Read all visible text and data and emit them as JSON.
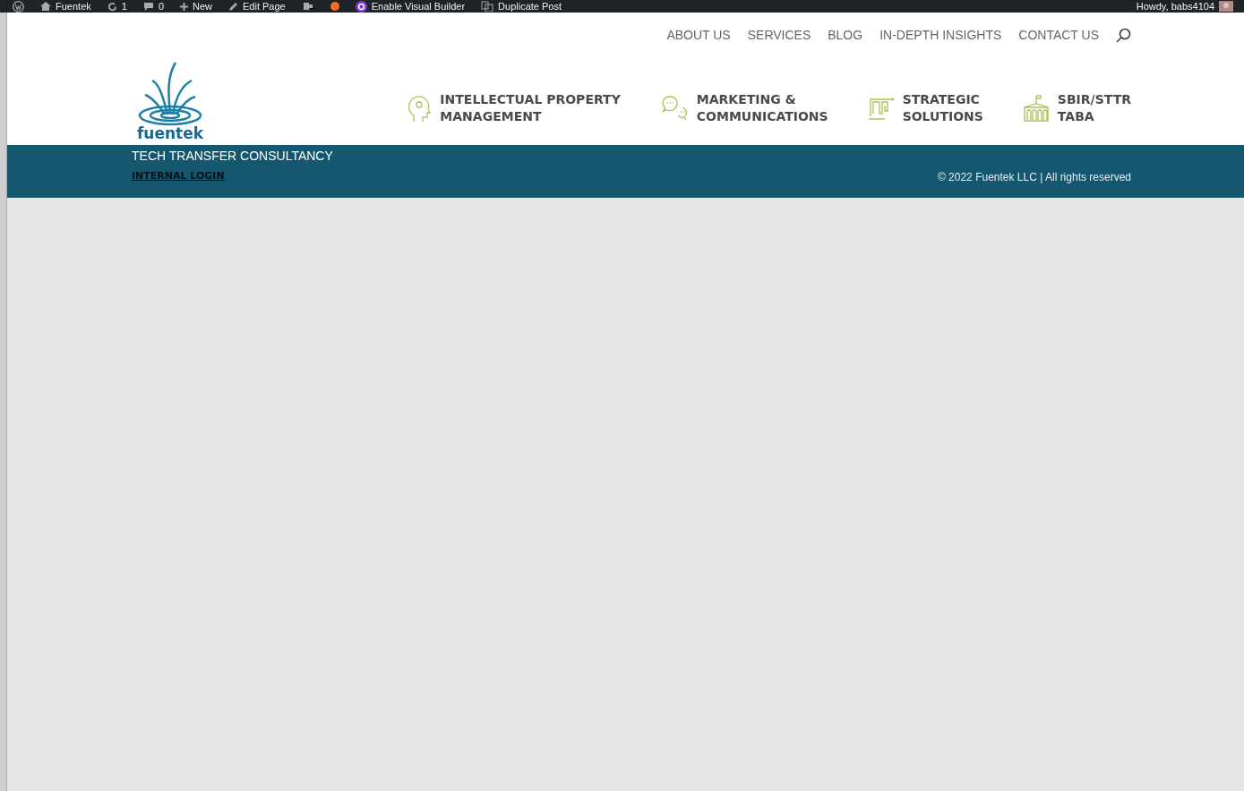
{
  "admin_bar": {
    "items": [
      {
        "kind": "logo"
      },
      {
        "kind": "site",
        "label": "Fuentek"
      },
      {
        "kind": "updates",
        "label": "1"
      },
      {
        "kind": "comments",
        "label": "0"
      },
      {
        "kind": "new",
        "label": "New"
      },
      {
        "kind": "edit",
        "label": "Edit Page"
      },
      {
        "kind": "plugin"
      },
      {
        "kind": "builder",
        "label": "Enable Visual Builder"
      },
      {
        "kind": "duplicate",
        "label": "Duplicate Post"
      }
    ],
    "greeting": "Howdy, babs4104"
  },
  "top_nav": [
    "ABOUT US",
    "SERVICES",
    "BLOG",
    "IN-DEPTH INSIGHTS",
    "CONTACT US"
  ],
  "logo": {
    "text": "fuentek"
  },
  "main_menu": [
    {
      "kind": "head",
      "lines": [
        "INTELLECTUAL PROPERTY",
        "MANAGEMENT"
      ]
    },
    {
      "kind": "chat",
      "lines": [
        "MARKETING &",
        "COMMUNICATIONS"
      ]
    },
    {
      "kind": "maze",
      "lines": [
        "STRATEGIC",
        "SOLUTIONS"
      ]
    },
    {
      "kind": "building",
      "lines": [
        "SBIR/STTR",
        "TABA"
      ]
    }
  ],
  "footer": {
    "tagline": "TECH TRANSFER CONSULTANCY",
    "login_link": "INTERNAL LOGIN",
    "copyright": "© 2022 Fuentek LLC | All rights reserved"
  }
}
